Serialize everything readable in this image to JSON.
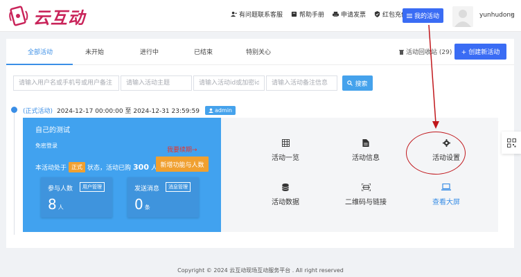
{
  "header": {
    "logo_text": "云互动",
    "nav": [
      {
        "label": "有问题联系客服",
        "icon": "user-service-icon"
      },
      {
        "label": "帮助手册",
        "icon": "book-icon"
      },
      {
        "label": "申请发票",
        "icon": "printer-icon"
      },
      {
        "label": "红包充值",
        "icon": "shield-icon"
      }
    ],
    "my_activity_label": "我的活动",
    "username": "yunhudong"
  },
  "tabs": [
    "全部活动",
    "未开始",
    "进行中",
    "已结束",
    "特别关心"
  ],
  "active_tab": 0,
  "recycle_label": "活动回收站 (29)",
  "create_label": "+ 创建新活动",
  "search": {
    "fields": [
      {
        "placeholder": "请输入用户名或手机号或用户备注"
      },
      {
        "placeholder": "请输入活动主题"
      },
      {
        "placeholder": "请输入活动id或加密id"
      },
      {
        "placeholder": "请输入活动备注信息"
      }
    ],
    "button_label": "搜索"
  },
  "activity": {
    "status": "(正式活动)",
    "time_range": "2024-12-17 00:00:00 至 2024-12-31 23:59:59",
    "owner_badge": "admin",
    "title": "自己的测试",
    "subtitle": "免密登录",
    "promo": "我要续期→",
    "status_prefix": "本活动处于",
    "version_tag": "正式",
    "status_mid": "状态，活动已购",
    "purchased": "300",
    "status_suffix": "人",
    "add_func_label": "新增功能与人数",
    "stats": [
      {
        "label": "参与人数",
        "manager": "用户管理",
        "value": "8",
        "unit": "人"
      },
      {
        "label": "发送消息",
        "manager": "消息管理",
        "value": "0",
        "unit": "条"
      }
    ],
    "actions": [
      {
        "label": "活动一览",
        "icon": "grid-icon"
      },
      {
        "label": "活动信息",
        "icon": "document-icon"
      },
      {
        "label": "活动设置",
        "icon": "gear-icon"
      },
      {
        "label": "活动数据",
        "icon": "database-icon"
      },
      {
        "label": "二维码与链接",
        "icon": "qrcode-scan-icon"
      },
      {
        "label": "查看大屏",
        "icon": "laptop-icon"
      }
    ]
  },
  "footer": "Copyright © 2024 云互动现场互动服务平台 . All right reserved",
  "colors": {
    "primary": "#3a6cf4",
    "card": "#41a2ef",
    "accent": "#f0a030",
    "annotation": "#c0161b"
  }
}
